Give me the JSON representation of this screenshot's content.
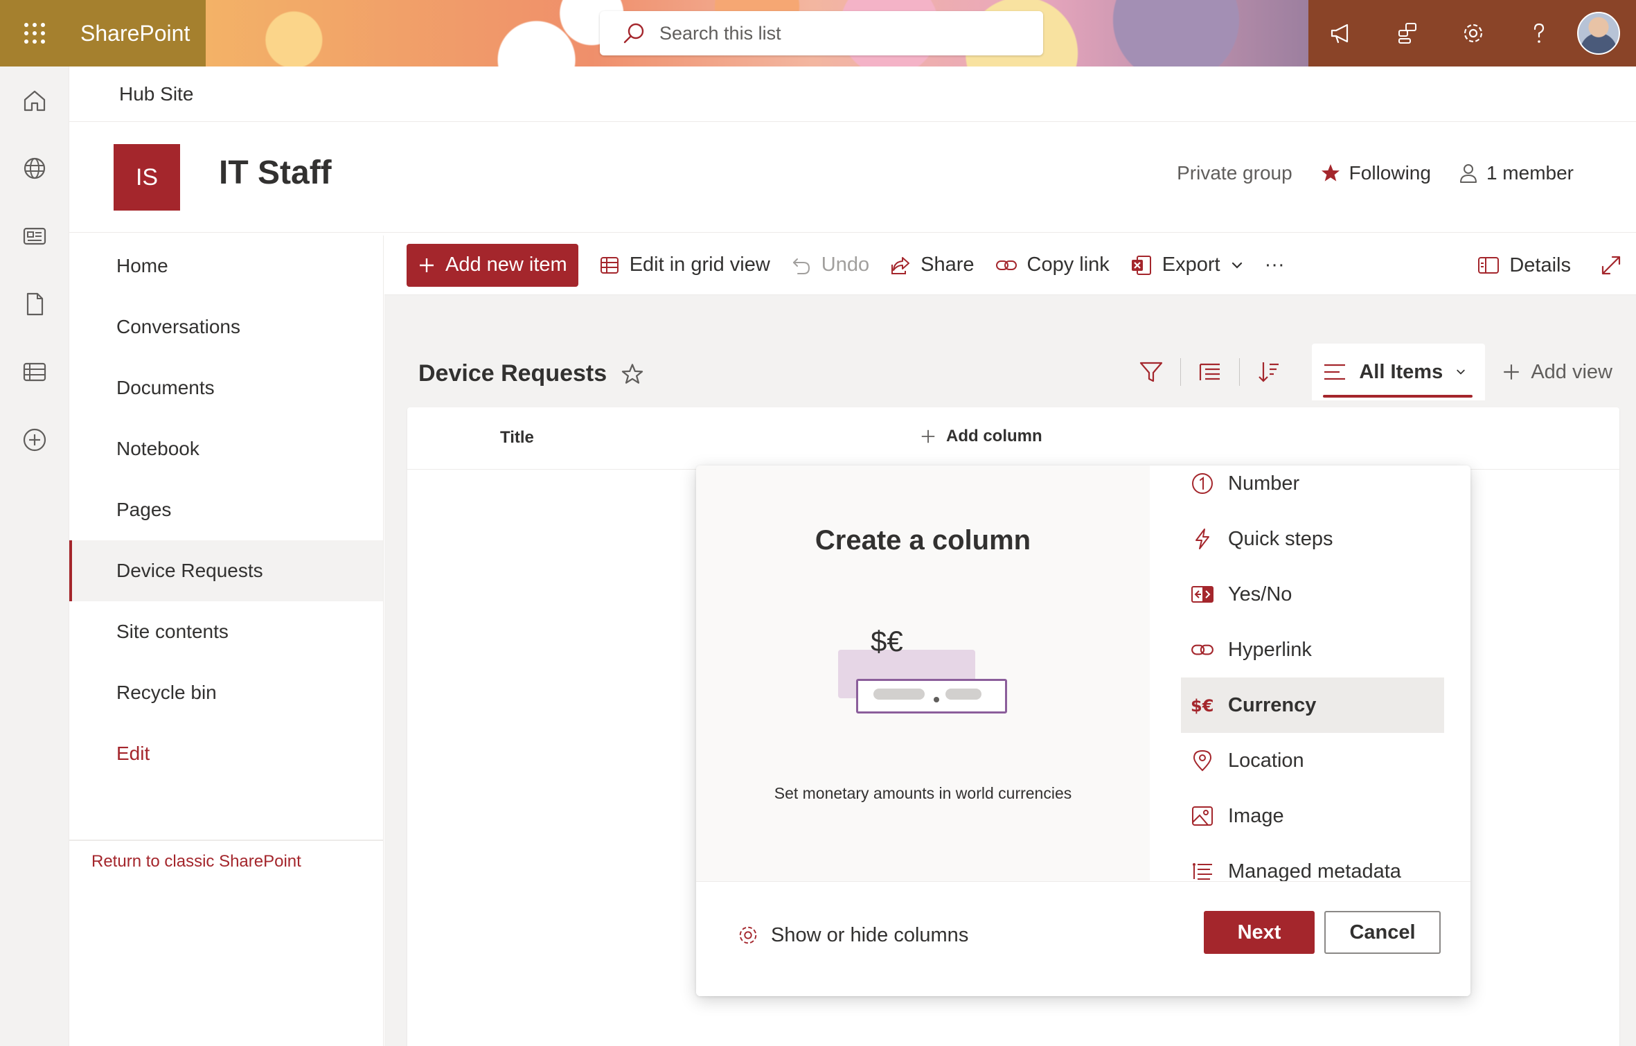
{
  "suite": {
    "brand": "SharePoint"
  },
  "search": {
    "placeholder": "Search this list"
  },
  "hub": {
    "label": "Hub Site"
  },
  "site": {
    "logo_initials": "IS",
    "title": "IT Staff",
    "privacy": "Private group",
    "following_label": "Following",
    "members_label": "1 member"
  },
  "nav": {
    "items": [
      {
        "label": "Home"
      },
      {
        "label": "Conversations"
      },
      {
        "label": "Documents"
      },
      {
        "label": "Notebook"
      },
      {
        "label": "Pages"
      },
      {
        "label": "Device Requests"
      },
      {
        "label": "Site contents"
      },
      {
        "label": "Recycle bin"
      }
    ],
    "edit_label": "Edit",
    "classic_link": "Return to classic SharePoint"
  },
  "commands": {
    "add_new_item": "Add new item",
    "edit_grid": "Edit in grid view",
    "undo": "Undo",
    "share": "Share",
    "copy_link": "Copy link",
    "export": "Export",
    "more": "···",
    "details": "Details"
  },
  "list": {
    "title": "Device Requests",
    "view_name": "All Items",
    "add_view": "Add view",
    "columns": {
      "title": "Title",
      "add_column": "Add column"
    }
  },
  "create_column": {
    "title": "Create a column",
    "preview_symbol": "$€",
    "description": "Set monetary amounts in world currencies",
    "types": [
      {
        "label": "Number",
        "icon": "number-circle-icon"
      },
      {
        "label": "Quick steps",
        "icon": "flash-icon"
      },
      {
        "label": "Yes/No",
        "icon": "toggle-icon"
      },
      {
        "label": "Hyperlink",
        "icon": "link-icon"
      },
      {
        "label": "Currency",
        "icon": "currency-icon"
      },
      {
        "label": "Location",
        "icon": "location-pin-icon"
      },
      {
        "label": "Image",
        "icon": "image-icon"
      },
      {
        "label": "Managed metadata",
        "icon": "tag-list-icon"
      }
    ],
    "selected_type": "Currency",
    "show_hide": "Show or hide columns",
    "next": "Next",
    "cancel": "Cancel"
  },
  "colors": {
    "accent": "#a4262c",
    "suite_bar": "#9b2c2e"
  }
}
